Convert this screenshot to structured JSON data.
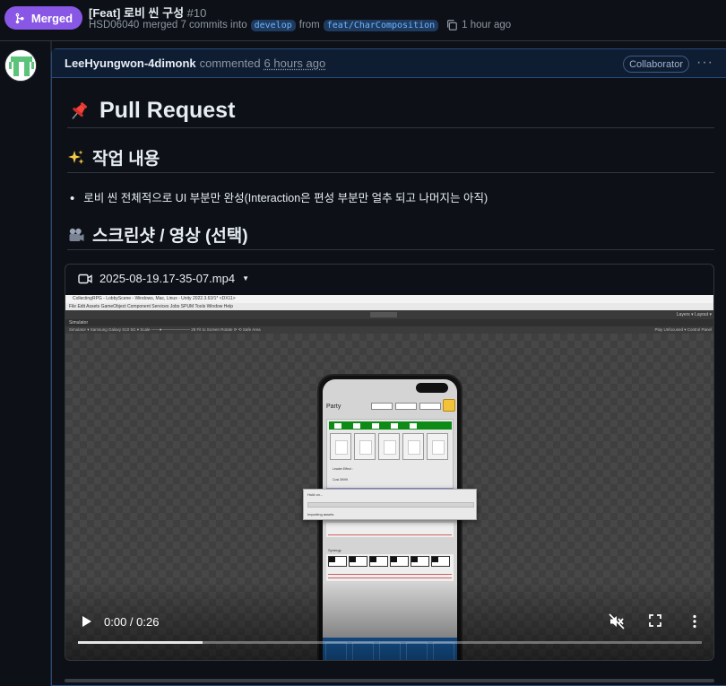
{
  "header": {
    "status_label": "Merged",
    "title": "[Feat] 로비 씬 구성",
    "number": "#10",
    "author": "HSD06040",
    "merged_text": "merged 7 commits into",
    "base_branch": "develop",
    "from_text": "from",
    "head_branch": "feat/CharComposition",
    "time": "1 hour ago"
  },
  "comment": {
    "author": "LeeHyungwon-4dimonk",
    "action": "commented",
    "time": "6 hours ago",
    "role_badge": "Collaborator",
    "heading": "Pull Request",
    "section1_heading": "작업 내용",
    "section1_items": [
      "로비 씬 전체적으로 UI 부분만 완성(Interaction은 편성 부분만 얼추 되고 나머지는 아직)"
    ],
    "section2_heading": "스크린샷 / 영상 (선택)"
  },
  "video": {
    "filename": "2025-08-19.17-35-07.mp4",
    "time_display": "0:00 / 0:26",
    "progress": 0.2,
    "frame": {
      "window_title": "CollectingRPG - LobbyScene - Windows, Mac, Linux - Unity 2022.3.61f1* <DX11>",
      "menu": "File   Edit   Assets   GameObject   Component   Services   Jobs   SPUM   Tools   Window   Help",
      "tab": "Simulator",
      "toolbar_left": "Simulator ▾   Samsung Galaxy S10 5G ▾   Scale ——●——————— 29    Fit to Screen    Rotate ⟳ ⟲   Safe Area",
      "toolbar_right": "Play Unfocused ▾   Control Panel",
      "toolbar_layers": "Layers ▾   Layout ▾",
      "party_title": "Party",
      "leader_text": "Leader Effect :",
      "cost_text": "Cost 39/99",
      "blue_bar_text": "Character 999/999       Team Chart star: 999/99/99",
      "synergy_text": "Synergy",
      "dialog_title": "Hold on...",
      "dialog_status": "Importing assets"
    }
  },
  "colors": {
    "merged": "#8957e5",
    "link_branch": "#6cb6ff",
    "comment_border": "#264a7a"
  }
}
